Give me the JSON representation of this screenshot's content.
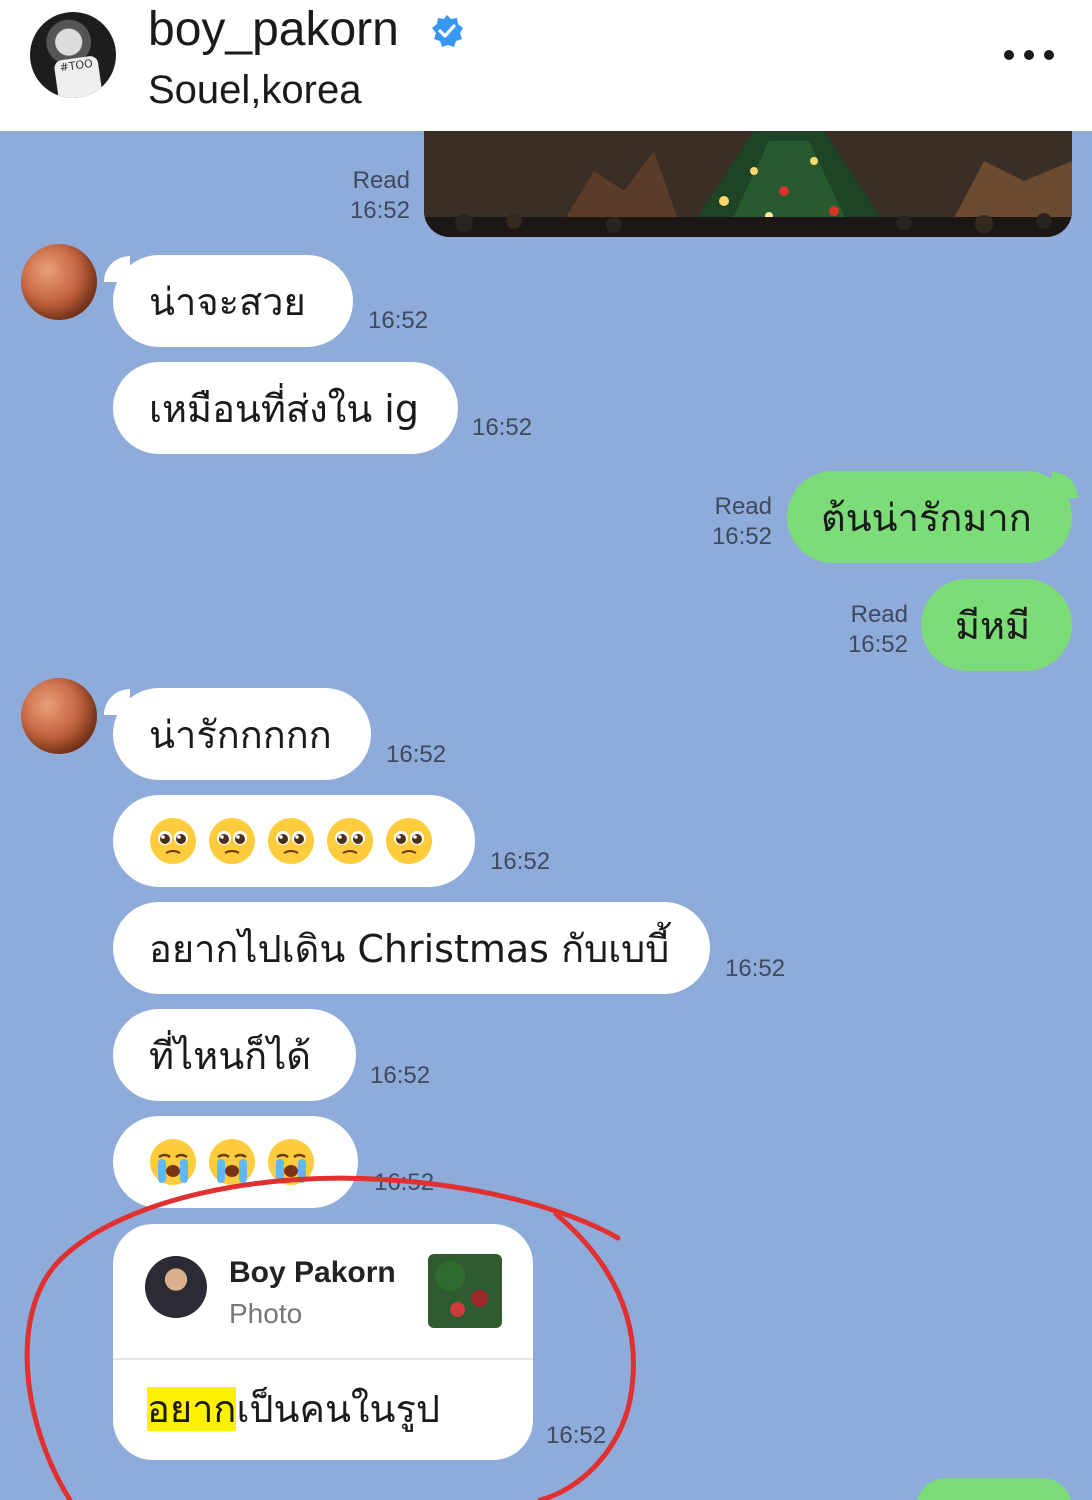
{
  "header": {
    "username": "boy_pakorn",
    "location": "Souel,korea",
    "avatar_shirt_text": "#TOO"
  },
  "colors": {
    "chat_background": "#8fabd9",
    "incoming_bubble": "#ffffff",
    "outgoing_bubble": "#7cdc78",
    "verified_blue": "#3897f0",
    "highlight": "#fff200",
    "annotation_red": "#e0302f"
  },
  "messages": {
    "photo_read": "Read",
    "photo_time": "16:52",
    "m1_text": "น่าจะสวย",
    "m1_time": "16:52",
    "m2_text": "เหมือนที่ส่งใน ig",
    "m2_time": "16:52",
    "m3_text": "ต้นน่ารักมาก",
    "m3_read": "Read",
    "m3_time": "16:52",
    "m4_text": "มีหมี",
    "m4_read": "Read",
    "m4_time": "16:52",
    "m5_text": "น่ารักกกกก",
    "m5_time": "16:52",
    "m6_emoji": "pleading-face-emoji",
    "m6_time": "16:52",
    "m7_text": "อยากไปเดิน Christmas กับเบบี้",
    "m7_time": "16:52",
    "m8_text": "ที่ไหนก็ได้",
    "m8_time": "16:52",
    "m9_emoji": "loudly-crying-face-emoji",
    "m9_time": "16:52"
  },
  "reply": {
    "name": "Boy Pakorn",
    "subtitle": "Photo",
    "text_highlight": "อยาก",
    "text_rest": "เป็นคนในรูป",
    "time": "16:52"
  }
}
